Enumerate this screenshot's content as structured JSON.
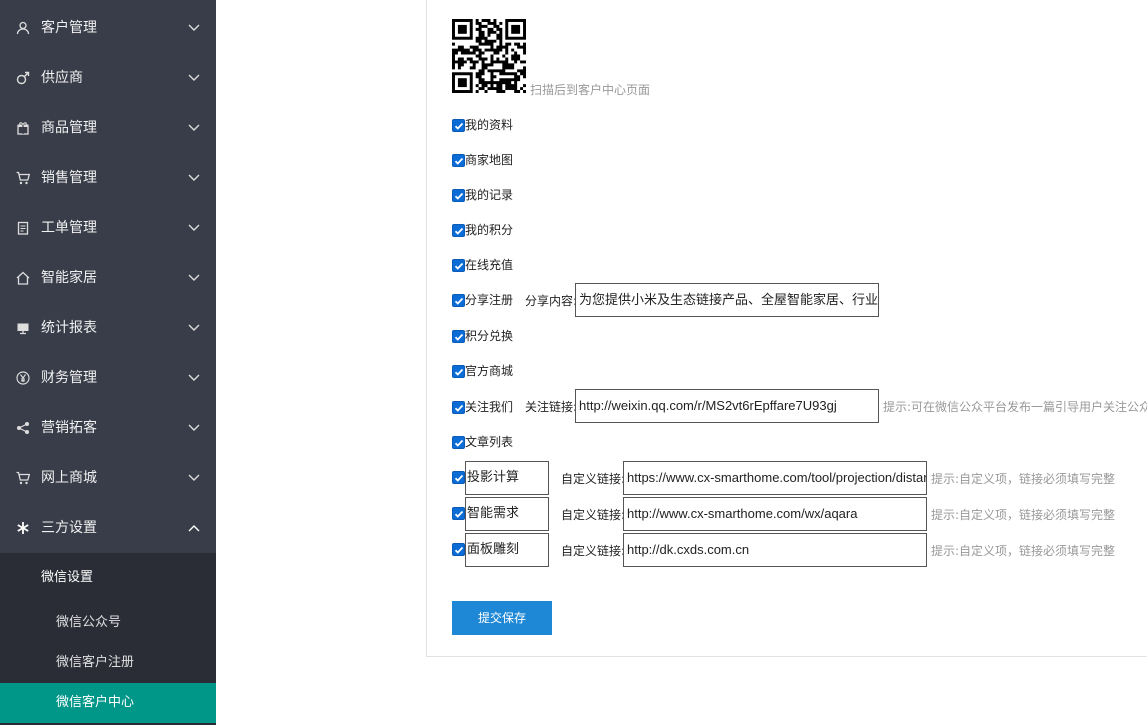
{
  "sidebar": {
    "items": [
      {
        "label": "客户管理",
        "icon": "user-icon"
      },
      {
        "label": "供应商",
        "icon": "male-icon"
      },
      {
        "label": "商品管理",
        "icon": "gift-icon"
      },
      {
        "label": "销售管理",
        "icon": "cart-icon"
      },
      {
        "label": "工单管理",
        "icon": "clipboard-icon"
      },
      {
        "label": "智能家居",
        "icon": "home-icon"
      },
      {
        "label": "统计报表",
        "icon": "monitor-icon"
      },
      {
        "label": "财务管理",
        "icon": "yen-icon"
      },
      {
        "label": "营销拓客",
        "icon": "share-icon"
      },
      {
        "label": "网上商城",
        "icon": "cart-icon"
      },
      {
        "label": "三方设置",
        "icon": "snowflake-icon"
      }
    ],
    "submenu_head": "微信设置",
    "submenu": [
      {
        "label": "微信公众号"
      },
      {
        "label": "微信客户注册"
      },
      {
        "label": "微信客户中心"
      }
    ],
    "active_submenu": "微信客户中心",
    "colors": {
      "bg": "#393d49",
      "sub_bg": "#2a2d35",
      "active": "#009688"
    }
  },
  "main": {
    "qr_hint": "扫描后到客户中心页面",
    "options": [
      {
        "label": "我的资料",
        "checked": true
      },
      {
        "label": "商家地图",
        "checked": true
      },
      {
        "label": "我的记录",
        "checked": true
      },
      {
        "label": "我的积分",
        "checked": true
      },
      {
        "label": "在线充值",
        "checked": true
      },
      {
        "label": "分享注册",
        "checked": true
      },
      {
        "label": "积分兑换",
        "checked": true
      },
      {
        "label": "官方商城",
        "checked": true
      },
      {
        "label": "关注我们",
        "checked": true
      },
      {
        "label": "文章列表",
        "checked": true
      }
    ],
    "share_label": "分享内容:",
    "share_value": "为您提供小米及生态链接产品、全屋智能家居、行业",
    "follow_label": "关注链接:",
    "follow_value": "http://weixin.qq.com/r/MS2vt6rEpffare7U93gj",
    "follow_hint": "提示:可在微信公众平台发布一篇引导用户关注公众号",
    "custom": [
      {
        "name": "投影计算",
        "link_label": "自定义链接:",
        "url": "https://www.cx-smarthome.com/tool/projection/distance",
        "hint": "提示:自定义项，链接必须填写完整",
        "checked": true
      },
      {
        "name": "智能需求",
        "link_label": "自定义链接:",
        "url": "http://www.cx-smarthome.com/wx/aqara",
        "hint": "提示:自定义项，链接必须填写完整",
        "checked": true
      },
      {
        "name": "面板雕刻",
        "link_label": "自定义链接:",
        "url": "http://dk.cxds.com.cn",
        "hint": "提示:自定义项，链接必须填写完整",
        "checked": true
      }
    ],
    "submit_label": "提交保存",
    "colors": {
      "checkbox": "#0b6cd6",
      "button": "#1e88d6"
    }
  }
}
